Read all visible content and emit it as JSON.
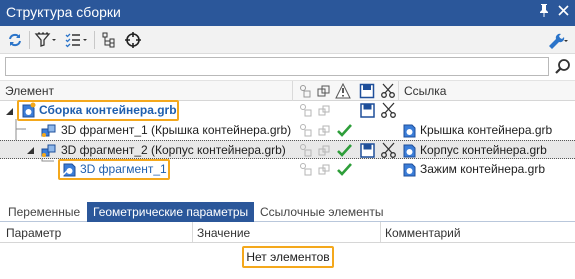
{
  "window": {
    "title": "Структура сборки",
    "pin_icon": "pin-icon",
    "close_icon": "close-icon"
  },
  "toolbar": {
    "buttons": [
      {
        "name": "refresh-button",
        "icon": "refresh-icon"
      },
      {
        "name": "filter-button",
        "icon": "filter-icon"
      },
      {
        "name": "list-options-button",
        "icon": "list-check-icon"
      },
      {
        "name": "tree-structure-button",
        "icon": "tree-icon"
      },
      {
        "name": "target-button",
        "icon": "crosshair-icon"
      },
      {
        "name": "settings-button",
        "icon": "wrench-icon"
      }
    ]
  },
  "search": {
    "value": "",
    "placeholder": "",
    "icon": "search-icon"
  },
  "tree": {
    "columns": {
      "element": "Элемент",
      "link": "Ссылка"
    },
    "rows": [
      {
        "label": "Сборка контейнера.grb",
        "level": 0,
        "link": "",
        "checked": false,
        "style": "bold"
      },
      {
        "label": "3D фрагмент_1 (Крышка контейнера.grb)",
        "level": 1,
        "link": "Крышка контейнера.grb",
        "checked": true,
        "style": "normal"
      },
      {
        "label": "3D фрагмент_2 (Корпус контейнера.grb)",
        "level": 1,
        "link": "Корпус контейнера.grb",
        "checked": true,
        "style": "normal"
      },
      {
        "label": "3D фрагмент_1",
        "level": 2,
        "link": "Зажим контейнера.grb",
        "checked": true,
        "style": "link"
      }
    ]
  },
  "tabs": [
    {
      "label": "Переменные",
      "active": false
    },
    {
      "label": "Геометрические параметры",
      "active": true
    },
    {
      "label": "Ссылочные элементы",
      "active": false
    }
  ],
  "params_grid": {
    "columns": [
      "Параметр",
      "Значение",
      "Комментарий"
    ],
    "empty_text": "Нет элементов"
  },
  "colors": {
    "titlebar": "#2b579a",
    "highlight_box": "#f4a81c",
    "accent_text": "#1f5fae",
    "check_green": "#2e9e3a"
  }
}
